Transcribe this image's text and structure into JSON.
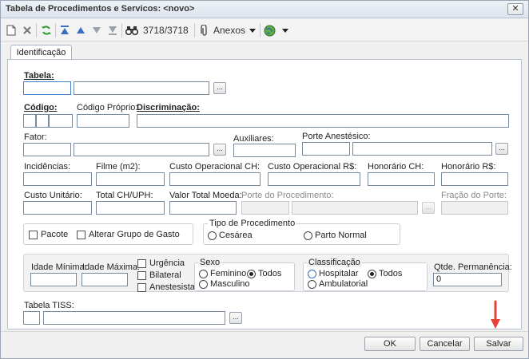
{
  "window": {
    "title": "Tabela de Procedimentos e Servicos: <novo>",
    "close_glyph": "✕"
  },
  "toolbar": {
    "record_counter": "3718/3718",
    "anexos_label": "Anexos"
  },
  "tabs": [
    {
      "label": "Identificação"
    }
  ],
  "form": {
    "tabela_label": "Tabela:",
    "codigo_label": "Código:",
    "codigo_proprio_label": "Código Próprio:",
    "discriminacao_label": "Discriminação:",
    "fator_label": "Fator:",
    "auxiliares_label": "Auxiliares:",
    "porte_anestesico_label": "Porte Anestésico:",
    "incidencias_label": "Incidências:",
    "filme_label": "Filme (m2):",
    "custo_operacional_ch_label": "Custo Operacional CH:",
    "custo_operacional_rs_label": "Custo Operacional R$:",
    "honorario_ch_label": "Honorário CH:",
    "honorario_rs_label": "Honorário R$:",
    "custo_unitario_label": "Custo Unitário:",
    "total_ch_uph_label": "Total CH/UPH:",
    "valor_total_moeda_label": "Valor Total Moeda:",
    "porte_procedimento_label": "Porte do Procedimento:",
    "fracao_porte_label": "Fração do Porte:",
    "pacote_label": "Pacote",
    "alterar_grupo_label": "Alterar Grupo de Gasto",
    "tipo_procedimento_label": "Tipo de Procedimento",
    "cesarea_label": "Cesárea",
    "parto_normal_label": "Parto Normal",
    "idade_minima_label": "Idade Mínima:",
    "idade_maxima_label": "Idade Máxima:",
    "urgencia_label": "Urgência",
    "bilateral_label": "Bilateral",
    "anestesista_label": "Anestesista",
    "sexo_label": "Sexo",
    "feminino_label": "Feminino",
    "masculino_label": "Masculino",
    "sexo_todos_label": "Todos",
    "classificacao_label": "Classificação",
    "hospitalar_label": "Hospitalar",
    "ambulatorial_label": "Ambulatorial",
    "class_todos_label": "Todos",
    "qtde_permanencia_label": "Qtde. Permanência:",
    "qtde_permanencia_value": "0",
    "tabela_tiss_label": "Tabela TISS:",
    "ellipsis": "..."
  },
  "footer": {
    "ok_label": "OK",
    "cancelar_label": "Cancelar",
    "salvar_label": "Salvar"
  },
  "colors": {
    "accent_arrow": "#e8413a",
    "focus_border": "#3f7fd0"
  }
}
